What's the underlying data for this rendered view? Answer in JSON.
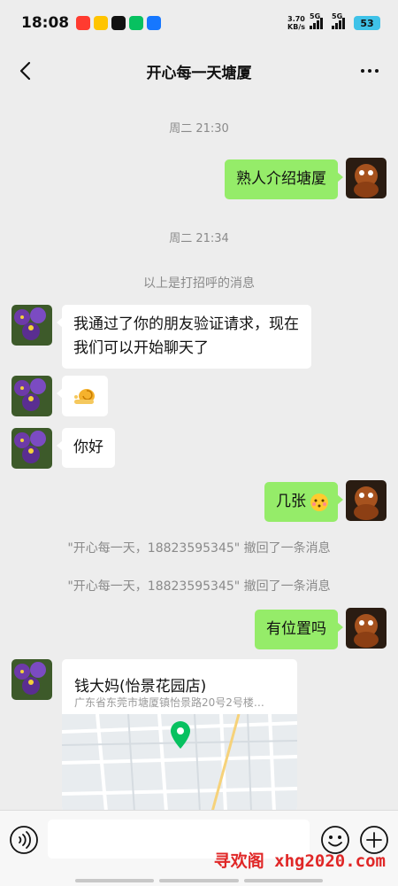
{
  "status": {
    "time": "18:08",
    "net_speed_value": "3.70",
    "net_speed_unit": "KB/s",
    "signal1": "5G",
    "signal2": "5G",
    "battery": "53"
  },
  "header": {
    "title": "开心每一天塘厦"
  },
  "messages": {
    "ts1": "周二 21:30",
    "msg1": "熟人介绍塘厦",
    "ts2": "周二 21:34",
    "sys_greeting": "以上是打招呼的消息",
    "msg2": "我通过了你的朋友验证请求，现在我们可以开始聊天了",
    "msg4": "你好",
    "msg5": "几张",
    "recall1": "\"开心每一天，18823595345\" 撤回了一条消息",
    "recall2": "\"开心每一天，18823595345\" 撤回了一条消息",
    "msg6": "有位置吗"
  },
  "location": {
    "name": "钱大妈(怡景花园店)",
    "address": "广东省东莞市塘厦镇怡景路20号2号楼…"
  },
  "watermark": "寻欢阁 xhg2020.com",
  "colors": {
    "bg": "#ededed",
    "my_bubble": "#95ec69",
    "their_bubble": "#ffffff",
    "battery": "#3fc2e8",
    "watermark": "#e02727"
  },
  "icons": [
    "back-arrow-icon",
    "more-icon",
    "voice-icon",
    "emoji-icon",
    "plus-icon",
    "location-pin-icon"
  ]
}
